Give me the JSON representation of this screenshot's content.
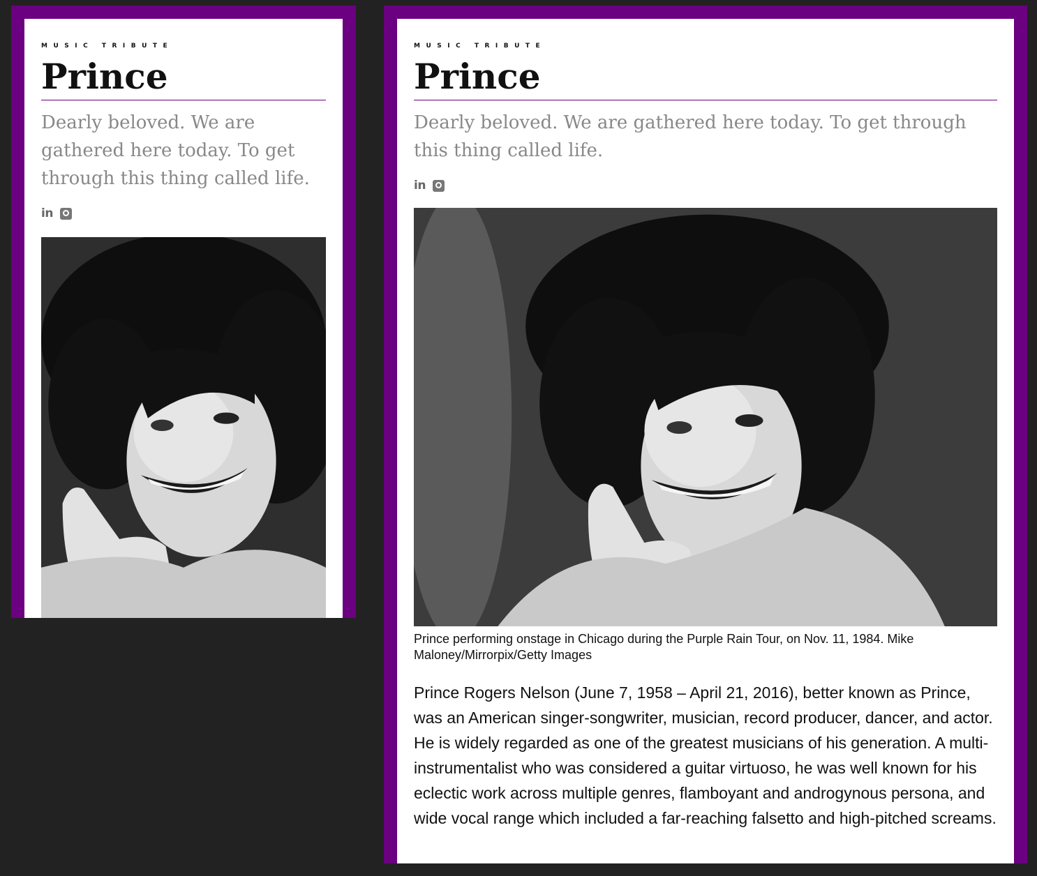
{
  "page": {
    "eyebrow": "MUSIC TRIBUTE",
    "title": "Prince",
    "subtitle": "Dearly beloved. We are gathered here today. To get through this thing called life.",
    "social": [
      {
        "icon": "linkedin-icon",
        "glyph": "in"
      },
      {
        "icon": "github-icon"
      }
    ],
    "photo": {
      "alt": "Prince performing onstage in Chicago during the Purple Rain Tour",
      "caption": "Prince performing onstage in Chicago during the Purple Rain Tour, on Nov. 11, 1984. Mike Maloney/Mirrorpix/Getty Images"
    },
    "body": "Prince Rogers Nelson (June 7, 1958 – April 21, 2016), better known as Prince, was an American singer-songwriter, musician, record producer, dancer, and actor. He is widely regarded as one of the greatest musicians of his generation. A multi-instrumentalist who was considered a guitar virtuoso, he was well known for his eclectic work across multiple genres, flamboyant and androgynous persona, and wide vocal range which included a far-reaching falsetto and high-pitched screams."
  },
  "colors": {
    "accent": "#6b0080",
    "background": "#222222",
    "card": "#ffffff",
    "subtitle": "#888888"
  }
}
